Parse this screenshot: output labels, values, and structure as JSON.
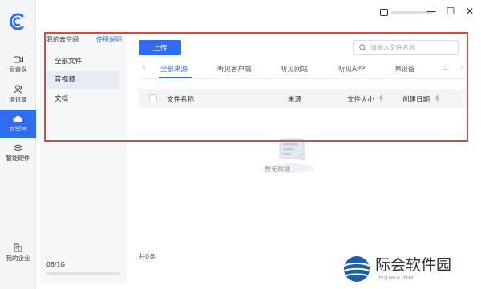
{
  "window": {
    "min_glyph": "—",
    "max_glyph": "☐",
    "close_glyph": "✕"
  },
  "nav": [
    {
      "label": "云会议",
      "icon": "video-icon"
    },
    {
      "label": "通讯录",
      "icon": "contacts-icon"
    },
    {
      "label": "云空间",
      "icon": "cloud-icon",
      "active": true
    },
    {
      "label": "智能硬件",
      "icon": "layers-icon"
    },
    {
      "label": "我的企业",
      "icon": "building-icon"
    }
  ],
  "folders": {
    "header": "我的云空间",
    "help": "使用说明",
    "items": [
      "全部文件",
      "音视频",
      "文档"
    ],
    "selected": "音视频",
    "storage_text": "0B/1G",
    "storage_used_fraction": 0
  },
  "main": {
    "upload_label": "上传",
    "search_placeholder": "请输入文件名称",
    "tabs": [
      "全部来源",
      "听见客户端",
      "听见网站",
      "听见APP",
      "M设备",
      "..."
    ],
    "active_tab": "全部来源",
    "columns": [
      "文件名称",
      "来源",
      "文件大小",
      "创建日期"
    ],
    "empty_text": "暂无数据",
    "count_text": "共0条"
  },
  "watermark": {
    "text": "际会软件园",
    "sub": "ZUJIHUI.TOP"
  },
  "colors": {
    "accent": "#2f6cf0",
    "highlight": "#e0443c"
  }
}
